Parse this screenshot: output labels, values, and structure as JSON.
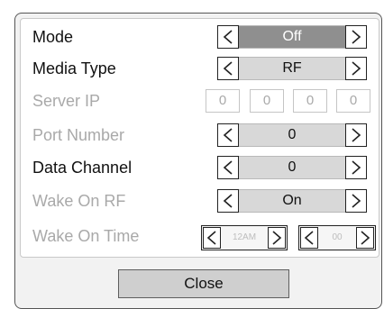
{
  "rows": {
    "mode": {
      "label": "Mode",
      "value": "Off"
    },
    "media_type": {
      "label": "Media Type",
      "value": "RF"
    },
    "server_ip": {
      "label": "Server IP",
      "octets": [
        "0",
        "0",
        "0",
        "0"
      ]
    },
    "port_number": {
      "label": "Port Number",
      "value": "0"
    },
    "data_channel": {
      "label": "Data Channel",
      "value": "0"
    },
    "wake_on_rf": {
      "label": "Wake On RF",
      "value": "On"
    },
    "wake_on_time": {
      "label": "Wake On Time",
      "hour": "12AM",
      "minute": "00"
    }
  },
  "footer": {
    "close_label": "Close"
  },
  "icons": {
    "prev": "chevron-left-icon",
    "next": "chevron-right-icon"
  }
}
